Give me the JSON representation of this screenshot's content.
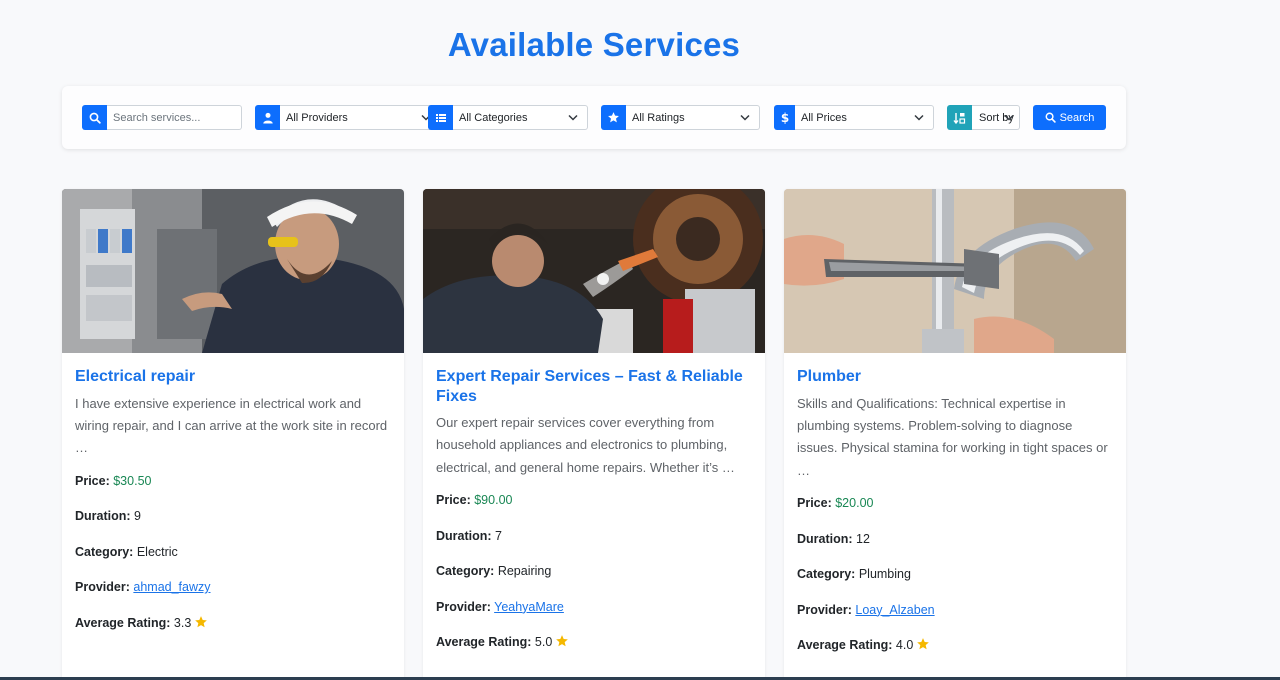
{
  "page": {
    "title": "Available Services"
  },
  "filters": {
    "search_placeholder": "Search services...",
    "providers": "All Providers",
    "categories": "All Categories",
    "ratings": "All Ratings",
    "prices": "All Prices",
    "sort": "Sort by",
    "search_button": "Search"
  },
  "labels": {
    "price": "Price:",
    "duration": "Duration:",
    "category": "Category:",
    "provider": "Provider:",
    "rating": "Average Rating:"
  },
  "colors": {
    "accent": "#1a73e8",
    "primary_button": "#0d6efd",
    "price_green": "#198754",
    "star": "#f5b800",
    "sort_icon": "#20a3b8"
  },
  "services": [
    {
      "title": "Electrical repair",
      "description": "I have extensive experience in electrical work and wiring repair, and I can arrive at the work site in record …",
      "price": "$30.50",
      "duration": "9",
      "category": "Electric",
      "provider": "ahmad_fawzy",
      "rating": "3.3",
      "image_icon": "electrician-photo"
    },
    {
      "title": "Expert Repair Services – Fast & Reliable Fixes",
      "description": "Our expert repair services cover everything from household appliances and electronics to plumbing, electrical, and general home repairs. Whether it’s …",
      "price": "$90.00",
      "duration": "7",
      "category": "Repairing",
      "provider": "YeahyaMare",
      "rating": "5.0",
      "image_icon": "mechanic-photo"
    },
    {
      "title": "Plumber",
      "description": "Skills and Qualifications: Technical expertise in plumbing systems. Problem-solving to diagnose issues. Physical stamina for working in tight spaces or …",
      "price": "$20.00",
      "duration": "12",
      "category": "Plumbing",
      "provider": "Loay_Alzaben",
      "rating": "4.0",
      "image_icon": "plumber-photo"
    }
  ]
}
